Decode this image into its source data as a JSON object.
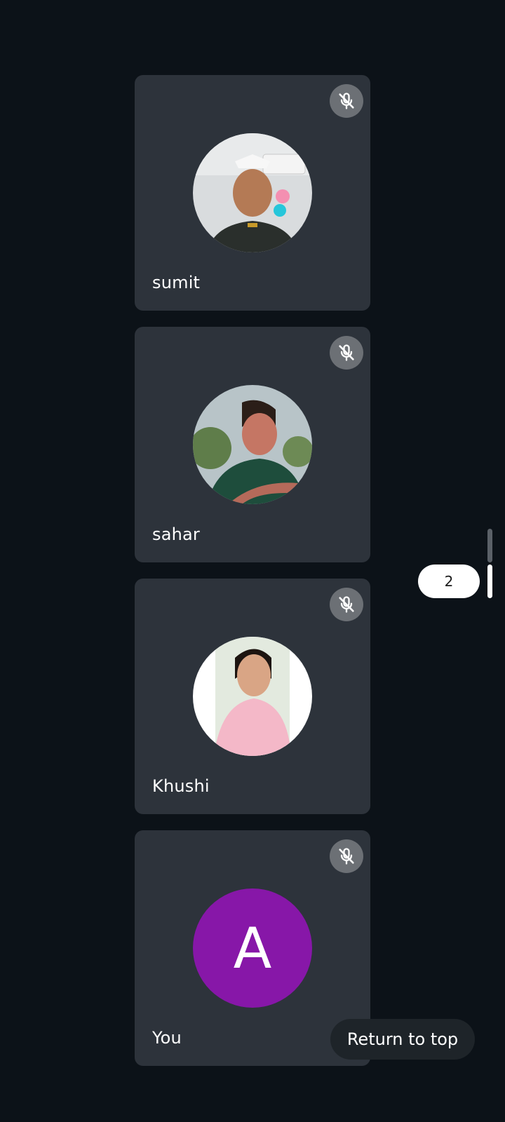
{
  "participants": [
    {
      "name": "sumit",
      "muted": true,
      "avatar": "photo"
    },
    {
      "name": "sahar",
      "muted": true,
      "avatar": "photo"
    },
    {
      "name": "Khushi",
      "muted": true,
      "avatar": "photo"
    },
    {
      "name": "You",
      "muted": true,
      "avatar": "letter",
      "avatar_letter": "A",
      "avatar_color": "#8717a8"
    }
  ],
  "pagination": {
    "current_page": "2"
  },
  "return_to_top": {
    "label": "Return to top"
  },
  "colors": {
    "background": "#0c1218",
    "tile": "#2d333b",
    "mute_button": "#6c7075"
  },
  "icons": {
    "mute": "mic-off-icon"
  }
}
